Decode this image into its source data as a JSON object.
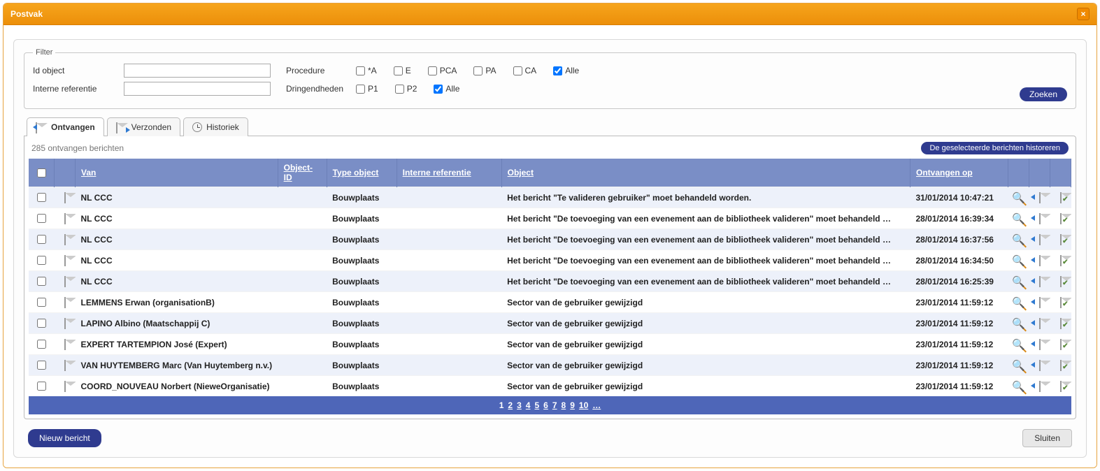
{
  "window": {
    "title": "Postvak"
  },
  "filter": {
    "legend": "Filter",
    "id_object_label": "Id object",
    "id_object_value": "",
    "internal_ref_label": "Interne referentie",
    "internal_ref_value": "",
    "procedure_label": "Procedure",
    "urgency_label": "Dringendheden",
    "proc_options": [
      {
        "label": "*A",
        "checked": false
      },
      {
        "label": "E",
        "checked": false
      },
      {
        "label": "PCA",
        "checked": false
      },
      {
        "label": "PA",
        "checked": false
      },
      {
        "label": "CA",
        "checked": false
      },
      {
        "label": "Alle",
        "checked": true
      }
    ],
    "urgency_options": [
      {
        "label": "P1",
        "checked": false
      },
      {
        "label": "P2",
        "checked": false
      },
      {
        "label": "Alle",
        "checked": true
      }
    ],
    "search_button": "Zoeken"
  },
  "tabs": [
    {
      "label": "Ontvangen",
      "active": true
    },
    {
      "label": "Verzonden",
      "active": false
    },
    {
      "label": "Historiek",
      "active": false
    }
  ],
  "status": "285 ontvangen berichten",
  "historize_button": "De geselecteerde berichten historeren",
  "columns": {
    "van": "Van",
    "object_id": "Object-ID",
    "type_object": "Type object",
    "interne_ref": "Interne referentie",
    "object": "Object",
    "ontvangen": "Ontvangen op"
  },
  "rows": [
    {
      "from": "NL CCC",
      "type": "Bouwplaats",
      "object": "Het bericht \"Te valideren gebruiker\" moet behandeld worden.",
      "received": "31/01/2014 10:47:21"
    },
    {
      "from": "NL CCC",
      "type": "Bouwplaats",
      "object": "Het bericht \"De toevoeging van een evenement aan de bibliotheek valideren\" moet behandeld …",
      "received": "28/01/2014 16:39:34"
    },
    {
      "from": "NL CCC",
      "type": "Bouwplaats",
      "object": "Het bericht \"De toevoeging van een evenement aan de bibliotheek valideren\" moet behandeld …",
      "received": "28/01/2014 16:37:56"
    },
    {
      "from": "NL CCC",
      "type": "Bouwplaats",
      "object": "Het bericht \"De toevoeging van een evenement aan de bibliotheek valideren\" moet behandeld …",
      "received": "28/01/2014 16:34:50"
    },
    {
      "from": "NL CCC",
      "type": "Bouwplaats",
      "object": "Het bericht \"De toevoeging van een evenement aan de bibliotheek valideren\" moet behandeld …",
      "received": "28/01/2014 16:25:39"
    },
    {
      "from": "LEMMENS Erwan (organisationB)",
      "type": "Bouwplaats",
      "object": "Sector van de gebruiker gewijzigd",
      "received": "23/01/2014 11:59:12"
    },
    {
      "from": "LAPINO Albino (Maatschappij C)",
      "type": "Bouwplaats",
      "object": "Sector van de gebruiker gewijzigd",
      "received": "23/01/2014 11:59:12"
    },
    {
      "from": "EXPERT TARTEMPION José (Expert)",
      "type": "Bouwplaats",
      "object": "Sector van de gebruiker gewijzigd",
      "received": "23/01/2014 11:59:12"
    },
    {
      "from": "VAN HUYTEMBERG Marc (Van Huytemberg n.v.)",
      "type": "Bouwplaats",
      "object": "Sector van de gebruiker gewijzigd",
      "received": "23/01/2014 11:59:12"
    },
    {
      "from": "COORD_NOUVEAU Norbert (NieweOrganisatie)",
      "type": "Bouwplaats",
      "object": "Sector van de gebruiker gewijzigd",
      "received": "23/01/2014 11:59:12"
    }
  ],
  "pager": {
    "pages": [
      "1",
      "2",
      "3",
      "4",
      "5",
      "6",
      "7",
      "8",
      "9",
      "10",
      "…"
    ],
    "current": "1"
  },
  "footer": {
    "new_message": "Nieuw bericht",
    "close": "Sluiten"
  }
}
